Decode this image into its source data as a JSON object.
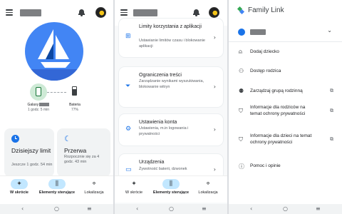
{
  "panel1": {
    "device": {
      "name": "Galaxy",
      "screen_time": "1 godz. 5 min"
    },
    "battery": {
      "label": "Bateria",
      "value": "77%",
      "level": 0.77
    },
    "cards": [
      {
        "title": "Dzisiejszy limit",
        "sub": "Jeszcze 1 godz. 54 min"
      },
      {
        "title": "Przerwa",
        "sub": "Rozpocznie się za 4 godz. 43 min"
      }
    ]
  },
  "panel2": {
    "items": [
      {
        "title": "Limity korzystania z aplikacji",
        "sub": "Ustawianie limitów czasu i blokowanie aplikacji",
        "icon": "apps-grid-icon"
      },
      {
        "title": "Ograniczenia treści",
        "sub": "Zarządzanie wynikami wyszukiwania, blokowanie witryn",
        "icon": "filter-icon"
      },
      {
        "title": "Ustawienia konta",
        "sub": "Ustawienia, m.in logowania i prywatności",
        "icon": "account-settings-icon"
      },
      {
        "title": "Urządzenia",
        "sub": "Żywotność baterii, dzwonek",
        "icon": "devices-icon"
      }
    ]
  },
  "nav": {
    "items": [
      {
        "label": "W skrócie",
        "icon": "sparkle-icon"
      },
      {
        "label": "Elementy sterujące",
        "icon": "sliders-icon"
      },
      {
        "label": "Lokalizacja",
        "icon": "location-pin-icon"
      }
    ]
  },
  "panel3": {
    "app_title": "Family Link",
    "menu": [
      {
        "label": "Dodaj dziecko",
        "icon": "person-add-icon"
      },
      {
        "label": "Dostęp rodzica",
        "icon": "parent-access-icon"
      },
      {
        "label": "Zarządzaj grupą rodzinną",
        "icon": "family-group-icon"
      },
      {
        "label": "Informacje dla rodziców na temat ochrony prywatności",
        "icon": "privacy-shield-icon"
      },
      {
        "label": "Informacje dla dzieci na temat ochrony prywatności",
        "icon": "privacy-shield-icon"
      },
      {
        "label": "Pomoc i opinie",
        "icon": "help-icon"
      }
    ]
  },
  "colors": {
    "accent": "#1a73e8",
    "brand_blue": "#4285f4",
    "nav_active": "#c2e7ff",
    "device_green": "#ceead6"
  }
}
